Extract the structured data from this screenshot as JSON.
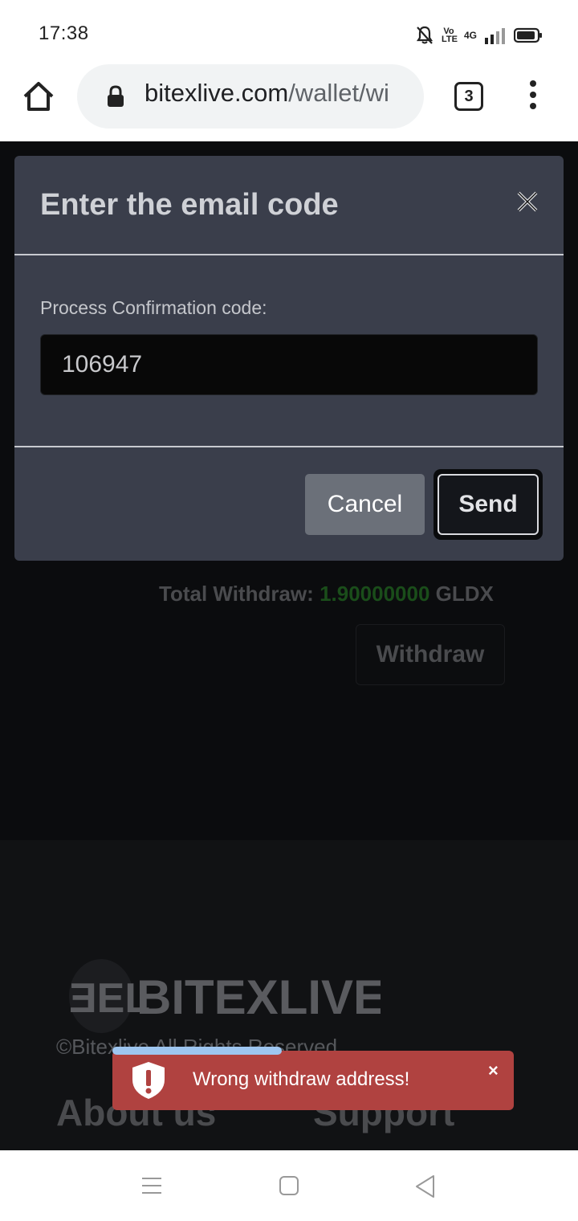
{
  "status_bar": {
    "time": "17:38",
    "volte": "Vo LTE",
    "network": "4G"
  },
  "browser": {
    "url_domain": "bitexlive.com",
    "url_path": "/wallet/wi",
    "tab_count": "3"
  },
  "page": {
    "total_label": "Total Withdraw:",
    "total_amount": "1.90000000",
    "total_currency": "GLDX",
    "withdraw_label": "Withdraw",
    "accent_green": "#1a4d1a"
  },
  "footer": {
    "logo_text": "BITEXLIVE",
    "copyright": "©Bitexlive All Rights Reserved",
    "about_label": "About us",
    "support_label": "Support"
  },
  "modal": {
    "title": "Enter the email code",
    "close_icon": "close-icon",
    "field_label": "Process Confirmation code:",
    "code_value": "106947",
    "cancel_label": "Cancel",
    "send_label": "Send"
  },
  "toast": {
    "message": "Wrong withdraw address!",
    "close_label": "×",
    "icon": "shield-alert-icon",
    "color": "#b04240",
    "progress_color": "#9ec6f0"
  }
}
